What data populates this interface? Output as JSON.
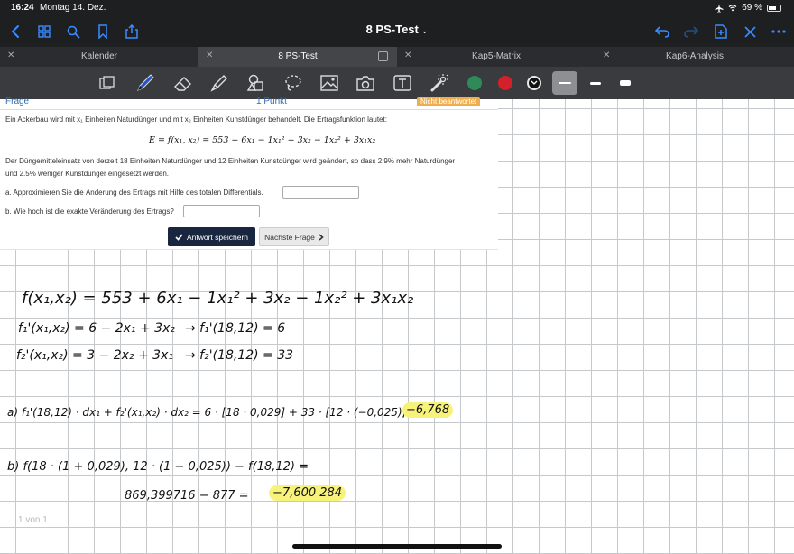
{
  "status_bar": {
    "time": "16:24",
    "date": "Montag 14. Dez.",
    "battery": "69 %",
    "battery_level": 0.69
  },
  "nav": {
    "doc_title": "8 PS-Test",
    "icons": [
      "chevron-left-icon",
      "grid-icon",
      "search-icon",
      "bookmark-icon",
      "share-icon",
      "undo-icon",
      "redo-icon",
      "add-page-icon",
      "close-icon",
      "more-icon"
    ]
  },
  "tabs": [
    {
      "label": "Kalender",
      "active": false
    },
    {
      "label": "8 PS-Test",
      "active": true
    },
    {
      "label": "Kap5-Matrix",
      "active": false
    },
    {
      "label": "Kap6-Analysis",
      "active": false
    }
  ],
  "toolbar": {
    "tools": [
      "readonly-icon",
      "pen-icon",
      "eraser-icon",
      "highlighter-icon",
      "shapes-icon",
      "lasso-icon",
      "image-icon",
      "camera-icon",
      "text-icon",
      "laser-pointer-icon"
    ],
    "colors": [
      "#2e8b57",
      "#d3202a",
      "#111111"
    ],
    "selected_color": "#111111"
  },
  "quiz": {
    "label": "Frage",
    "points": "1 Punkt",
    "status": "Nicht beantwortet",
    "intro": "Ein Ackerbau wird mit x₁  Einheiten Naturdünger und mit x₂  Einheiten Kunstdünger behandelt. Die Ertragsfunktion lautet:",
    "formula": "E = f(x₁, x₂) = 553 + 6x₁ − 1x₁² + 3x₂ − 1x₂² + 3x₁x₂",
    "change_line1": "Der Düngemitteleinsatz von derzeit 18 Einheiten Naturdünger und 12 Einheiten Kunstdünger wird geändert, so dass 2.9% mehr Naturdünger",
    "change_line2": "und 2.5% weniger Kunstdünger eingesetzt werden.",
    "question_a": "a. Approximieren Sie die Änderung des Ertrags mit Hilfe des totalen Differentials.",
    "question_b": "b. Wie hoch ist die exakte Veränderung des Ertrags?",
    "save_label": "Antwort speichern",
    "next_label": "Nächste Frage"
  },
  "notes": {
    "line1": "f(x₁,x₂) = 553 + 6x₁ − 1x₁² + 3x₂ − 1x₂² + 3x₁x₂",
    "line2": "f₁'(x₁,x₂) = 6 − 2x₁ + 3x₂",
    "line2b": "→ f₁'(18,12) = 6",
    "line3": "f₂'(x₁,x₂) = 3 − 2x₂ + 3x₁",
    "line3b": "→ f₂'(18,12) = 33",
    "line_a": "a)  f₁'(18,12) · dx₁ + f₂'(x₁,x₂) · dx₂ = 6 · [18 · 0,029] + 33 · [12 · (−0,025)] =",
    "result_a": "−6,768",
    "line_b": "b)  f(18 · (1 + 0,029), 12 · (1 − 0,025)) − f(18,12) =",
    "line_b2": "869,399716 − 877   =",
    "result_b": "−7,600 284"
  },
  "page_count": "1 von 1"
}
